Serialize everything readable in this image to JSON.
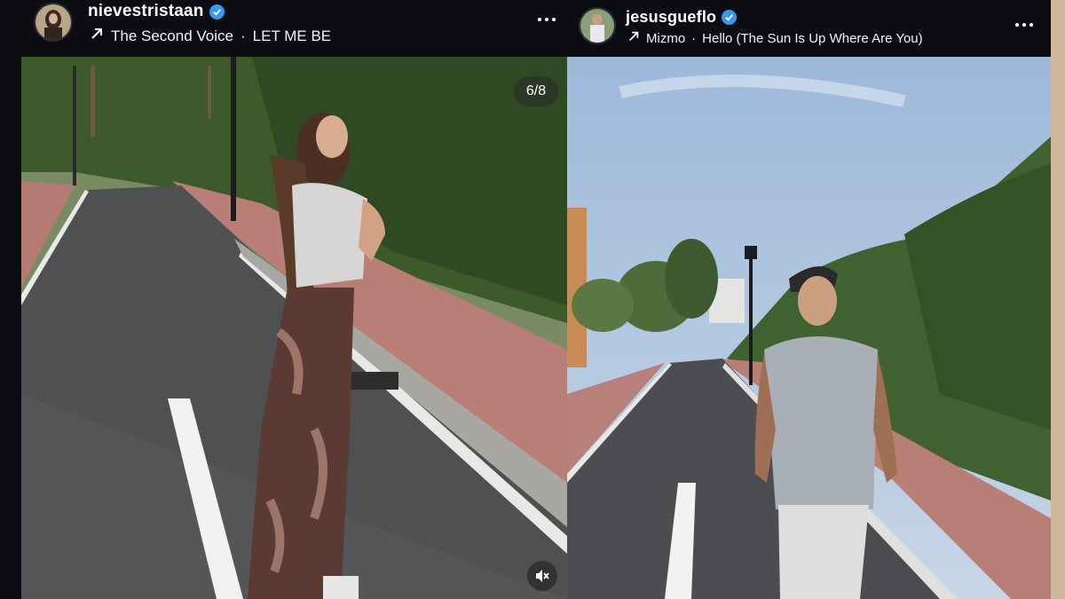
{
  "posts": [
    {
      "username": "nievestristaan",
      "verified": true,
      "audio_artist": "The Second Voice",
      "audio_title": "LET ME BE",
      "audio_separator": "·",
      "media_counter": "6/8",
      "icons": [
        "avatar",
        "verified-badge-icon",
        "music-arrow-icon",
        "more-options-icon",
        "muted-speaker-icon"
      ]
    },
    {
      "username": "jesusgueflo",
      "verified": true,
      "audio_artist": "Mizmo",
      "audio_title": "Hello (The Sun Is Up Where Are You)",
      "audio_separator": "·",
      "icons": [
        "avatar",
        "verified-badge-icon",
        "music-arrow-icon",
        "more-options-icon"
      ]
    }
  ],
  "colors": {
    "background": "#0b0d12",
    "verified_blue": "#3897f0",
    "text": "#ffffff"
  }
}
